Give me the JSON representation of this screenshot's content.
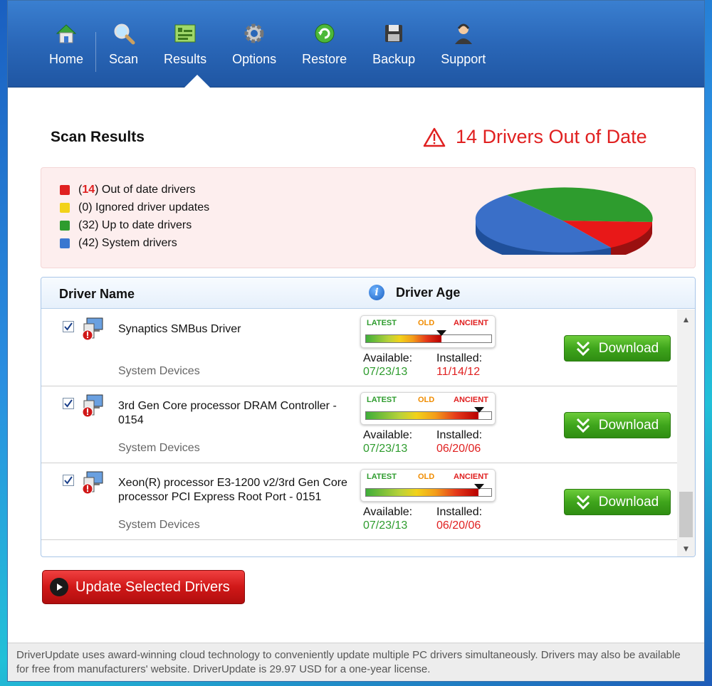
{
  "nav": {
    "items": [
      {
        "label": "Home",
        "icon": "home-icon"
      },
      {
        "label": "Scan",
        "icon": "magnifier-icon"
      },
      {
        "label": "Results",
        "icon": "results-icon"
      },
      {
        "label": "Options",
        "icon": "gear-icon"
      },
      {
        "label": "Restore",
        "icon": "restore-icon"
      },
      {
        "label": "Backup",
        "icon": "floppy-icon"
      },
      {
        "label": "Support",
        "icon": "support-person-icon"
      }
    ],
    "active": "Results"
  },
  "header": {
    "title": "Scan Results",
    "alert": "14 Drivers Out of Date"
  },
  "summary": {
    "legend": [
      {
        "count": "14",
        "label": "Out of date drivers",
        "color": "#e02020"
      },
      {
        "count": "0",
        "label": "Ignored driver updates",
        "color": "#f2d21a"
      },
      {
        "count": "32",
        "label": "Up to date drivers",
        "color": "#2e9c2e"
      },
      {
        "count": "42",
        "label": "System drivers",
        "color": "#3a78d0"
      }
    ]
  },
  "table": {
    "col_name": "Driver Name",
    "col_age": "Driver Age",
    "gauge_labels": {
      "latest": "LATEST",
      "old": "OLD",
      "ancient": "ANCIENT"
    },
    "available_label": "Available:",
    "installed_label": "Installed:",
    "download_label": "Download",
    "rows": [
      {
        "name": "Synaptics SMBus Driver",
        "category": "System Devices",
        "available": "07/23/13",
        "installed": "11/14/12",
        "checked": true,
        "age_level": 0.6
      },
      {
        "name": "3rd Gen Core processor DRAM Controller - 0154",
        "category": "System Devices",
        "available": "07/23/13",
        "installed": "06/20/06",
        "checked": true,
        "age_level": 0.9
      },
      {
        "name": "Xeon(R) processor E3-1200 v2/3rd Gen Core processor PCI Express Root Port - 0151",
        "category": "System Devices",
        "available": "07/23/13",
        "installed": "06/20/06",
        "checked": true,
        "age_level": 0.9
      }
    ]
  },
  "actions": {
    "update_label": "Update Selected Drivers"
  },
  "footer": {
    "text": "DriverUpdate uses award-winning cloud technology to conveniently update multiple PC drivers simultaneously. Drivers may also be available for free from manufacturers' website. DriverUpdate is 29.97 USD for a one-year license."
  }
}
